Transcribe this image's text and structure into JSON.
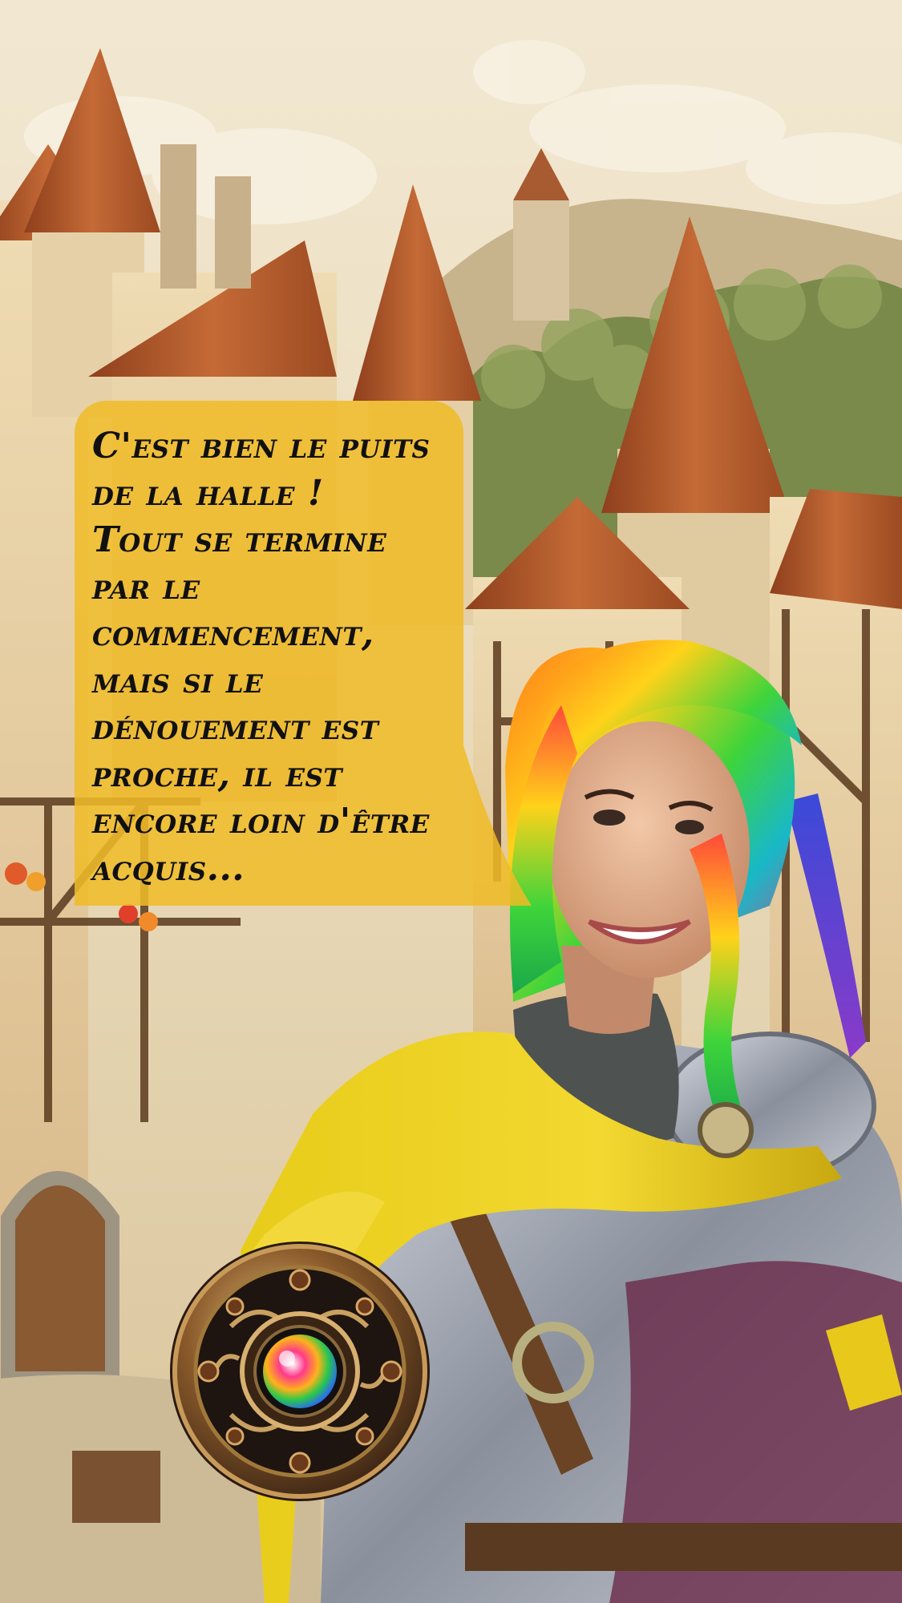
{
  "dialogue": {
    "text": "C'est bien le puits\nde la halle !\nTout se termine\npar le\ncommencement,\nmais si le\ndénouement est\nproche, il est\nencore loin d'être\nacquis..."
  },
  "colors": {
    "bubble": "#f0bc28",
    "scarf": "#e8c818",
    "gem": "rainbow",
    "roof": "#b25a2c",
    "sky": "#eadfc4"
  },
  "icons": {
    "medallion": "rainbow-gem-medallion-icon"
  }
}
